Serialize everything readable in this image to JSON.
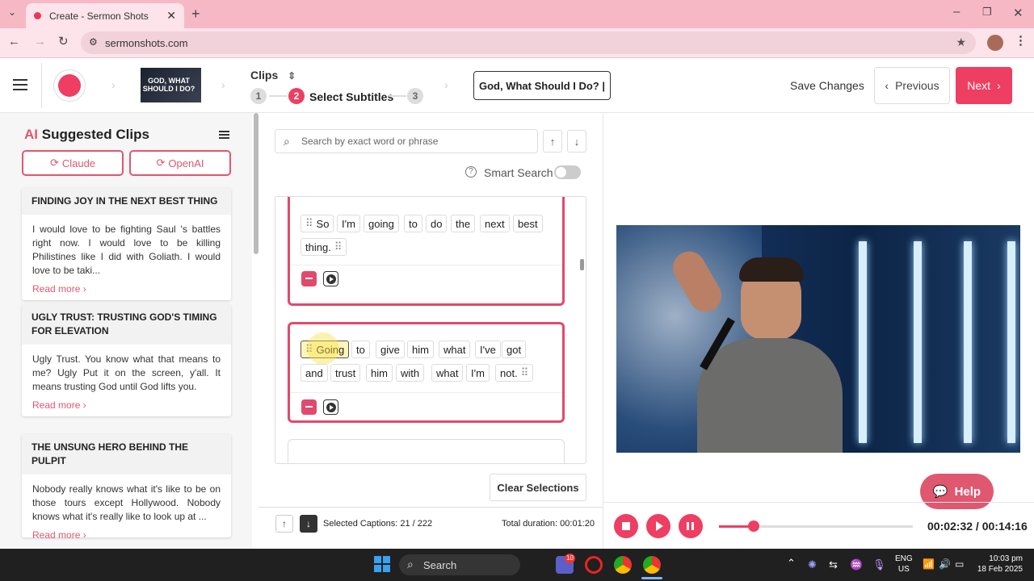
{
  "browser": {
    "tab_title": "Create - Sermon Shots",
    "url": "sermonshots.com"
  },
  "header": {
    "thumbnail_text": "GOD, WHAT SHOULD I DO?",
    "clips_label": "Clips",
    "steps": [
      {
        "number": "1"
      },
      {
        "number": "2",
        "label": "Select Subtitles"
      },
      {
        "number": "3"
      }
    ],
    "title_value": "God, What Should I Do? |",
    "save_changes": "Save Changes",
    "previous": "Previous",
    "next": "Next"
  },
  "sidebar": {
    "title_prefix": "AI",
    "title": "Suggested Clips",
    "claude_btn": "Claude",
    "openai_btn": "OpenAI",
    "read_more": "Read more",
    "cards": [
      {
        "title": "FINDING JOY IN THE NEXT BEST THING",
        "body": "I would love to be fighting Saul 's battles right now. I would love to be killing Philistines like I did with Goliath. I would love to be taki..."
      },
      {
        "title": "UGLY TRUST: TRUSTING GOD'S TIMING FOR ELEVATION",
        "body": "Ugly Trust. You know what that means to me? Ugly Put it on the screen, y'all. It means trusting God until God lifts you."
      },
      {
        "title": "THE UNSUNG HERO BEHIND THE PULPIT",
        "body": "Nobody really knows what it's like to be on those tours except Hollywood. Nobody knows what it's really like to look up at ..."
      }
    ]
  },
  "editor": {
    "search_placeholder": "Search by exact word or phrase",
    "smart_search_label": "Smart Search",
    "smart_search_on": false,
    "clips": [
      {
        "words": [
          "So",
          "I'm",
          "going",
          "to",
          "do",
          "the",
          "next",
          "best",
          "thing."
        ]
      },
      {
        "words": [
          "Going",
          "to",
          "give",
          "him",
          "what",
          "I've",
          "got",
          "and",
          "trust",
          "him",
          "with",
          "what",
          "I'm",
          "not."
        ]
      }
    ],
    "clear_selections": "Clear Selections",
    "selected_captions": "Selected Captions: 21 / 222",
    "total_duration": "Total duration: 00:01:20"
  },
  "player": {
    "help": "Help",
    "time": "00:02:32 / 00:14:16",
    "progress": 0.18
  },
  "taskbar": {
    "search": "Search",
    "lang_top": "ENG",
    "lang_bottom": "US",
    "clock_time": "10:03 pm",
    "clock_date": "18 Feb 2025",
    "notification_count": "10"
  }
}
